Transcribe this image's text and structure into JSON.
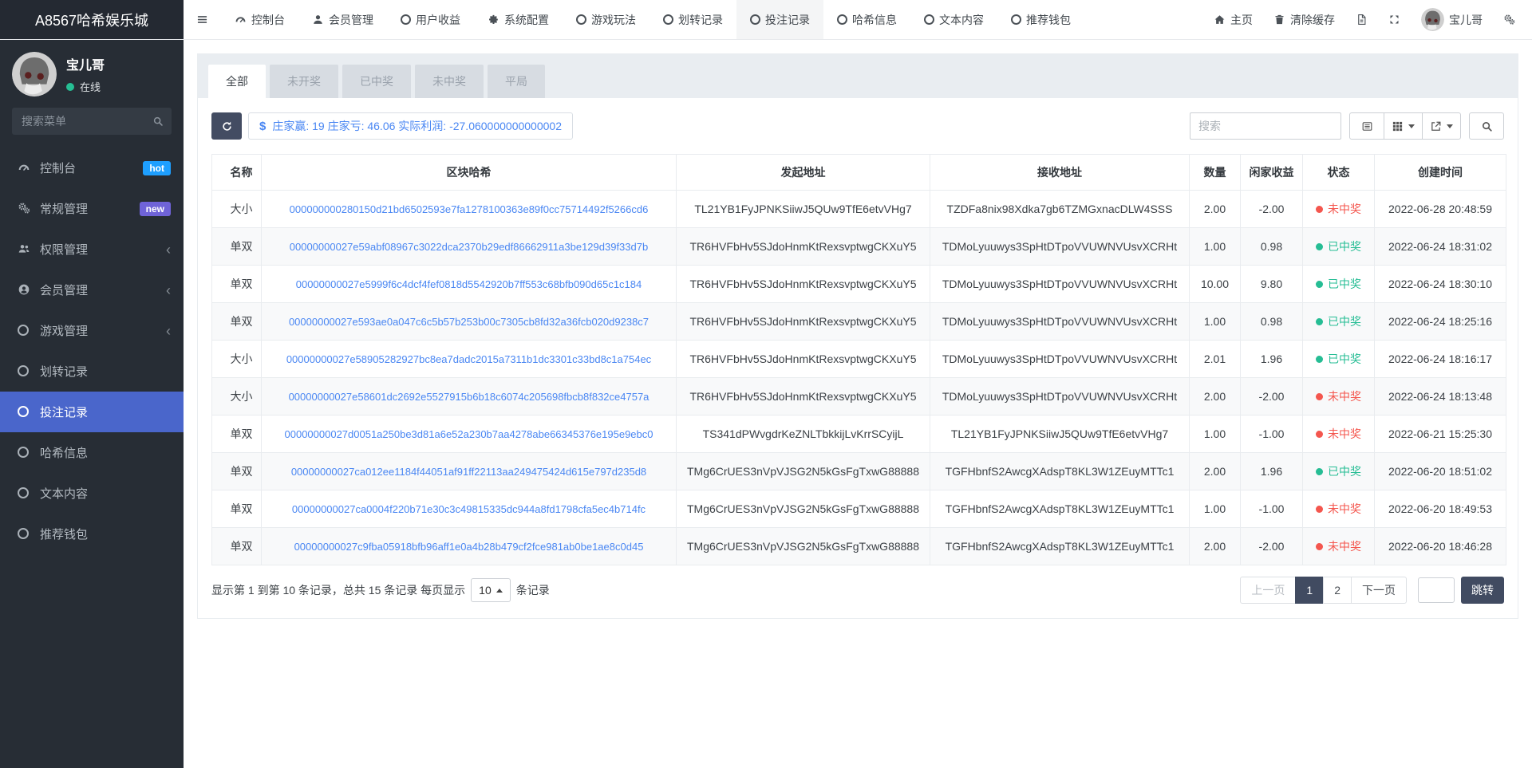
{
  "navbar": {
    "brand": "A8567哈希娱乐城",
    "items": [
      {
        "label": "控制台",
        "icon": "gauge-icon"
      },
      {
        "label": "会员管理",
        "icon": "user-icon"
      },
      {
        "label": "用户收益",
        "icon": "circle-icon"
      },
      {
        "label": "系统配置",
        "icon": "gear-icon"
      },
      {
        "label": "游戏玩法",
        "icon": "circle-icon"
      },
      {
        "label": "划转记录",
        "icon": "circle-icon"
      },
      {
        "label": "投注记录",
        "icon": "circle-icon",
        "active": true
      },
      {
        "label": "哈希信息",
        "icon": "circle-icon"
      },
      {
        "label": "文本内容",
        "icon": "circle-icon"
      },
      {
        "label": "推荐钱包",
        "icon": "circle-icon"
      }
    ],
    "right": {
      "home": "主页",
      "clear_cache": "清除缓存",
      "username": "宝儿哥"
    }
  },
  "sidebar": {
    "username": "宝儿哥",
    "status": "在线",
    "search_placeholder": "搜索菜单",
    "items": [
      {
        "label": "控制台",
        "icon": "gauge-icon",
        "badge": "hot",
        "badge_color": "#1e9fff"
      },
      {
        "label": "常规管理",
        "icon": "cogs-icon",
        "badge": "new",
        "badge_color": "#6f63d8"
      },
      {
        "label": "权限管理",
        "icon": "users-icon",
        "arrow": true
      },
      {
        "label": "会员管理",
        "icon": "user-circle-icon",
        "arrow": true
      },
      {
        "label": "游戏管理",
        "icon": "circle-icon",
        "arrow": true
      },
      {
        "label": "划转记录",
        "icon": "circle-icon"
      },
      {
        "label": "投注记录",
        "icon": "circle-icon",
        "active": true
      },
      {
        "label": "哈希信息",
        "icon": "circle-icon"
      },
      {
        "label": "文本内容",
        "icon": "circle-icon"
      },
      {
        "label": "推荐钱包",
        "icon": "circle-icon"
      }
    ]
  },
  "tabs": [
    {
      "label": "全部",
      "active": true
    },
    {
      "label": "未开奖"
    },
    {
      "label": "已中奖"
    },
    {
      "label": "未中奖"
    },
    {
      "label": "平局"
    }
  ],
  "toolbar": {
    "stats_symbol": "$",
    "stats_text": "庄家赢: 19 庄家亏: 46.06 实际利润: -27.060000000000002",
    "search_placeholder": "搜索"
  },
  "table": {
    "headers": [
      "名称",
      "区块哈希",
      "发起地址",
      "接收地址",
      "数量",
      "闲家收益",
      "状态",
      "创建时间"
    ],
    "rows": [
      {
        "name": "大小",
        "hash": "000000000280150d21bd6502593e7fa1278100363e89f0cc75714492f5266cd6",
        "from": "TL21YB1FyJPNKSiiwJ5QUw9TfE6etvVHg7",
        "to": "TZDFa8nix98Xdka7gb6TZMGxnacDLW4SSS",
        "amount": "2.00",
        "profit": "-2.00",
        "status": "未中奖",
        "status_class": "lose",
        "time": "2022-06-28 20:48:59"
      },
      {
        "name": "单双",
        "hash": "00000000027e59abf08967c3022dca2370b29edf86662911a3be129d39f33d7b",
        "from": "TR6HVFbHv5SJdoHnmKtRexsvptwgCKXuY5",
        "to": "TDMoLyuuwys3SpHtDTpoVVUWNVUsvXCRHt",
        "amount": "1.00",
        "profit": "0.98",
        "status": "已中奖",
        "status_class": "win",
        "time": "2022-06-24 18:31:02"
      },
      {
        "name": "单双",
        "hash": "00000000027e5999f6c4dcf4fef0818d5542920b7ff553c68bfb090d65c1c184",
        "from": "TR6HVFbHv5SJdoHnmKtRexsvptwgCKXuY5",
        "to": "TDMoLyuuwys3SpHtDTpoVVUWNVUsvXCRHt",
        "amount": "10.00",
        "profit": "9.80",
        "status": "已中奖",
        "status_class": "win",
        "time": "2022-06-24 18:30:10"
      },
      {
        "name": "单双",
        "hash": "00000000027e593ae0a047c6c5b57b253b00c7305cb8fd32a36fcb020d9238c7",
        "from": "TR6HVFbHv5SJdoHnmKtRexsvptwgCKXuY5",
        "to": "TDMoLyuuwys3SpHtDTpoVVUWNVUsvXCRHt",
        "amount": "1.00",
        "profit": "0.98",
        "status": "已中奖",
        "status_class": "win",
        "time": "2022-06-24 18:25:16"
      },
      {
        "name": "大小",
        "hash": "00000000027e58905282927bc8ea7dadc2015a7311b1dc3301c33bd8c1a754ec",
        "from": "TR6HVFbHv5SJdoHnmKtRexsvptwgCKXuY5",
        "to": "TDMoLyuuwys3SpHtDTpoVVUWNVUsvXCRHt",
        "amount": "2.01",
        "profit": "1.96",
        "status": "已中奖",
        "status_class": "win",
        "time": "2022-06-24 18:16:17"
      },
      {
        "name": "大小",
        "hash": "00000000027e58601dc2692e5527915b6b18c6074c205698fbcb8f832ce4757a",
        "from": "TR6HVFbHv5SJdoHnmKtRexsvptwgCKXuY5",
        "to": "TDMoLyuuwys3SpHtDTpoVVUWNVUsvXCRHt",
        "amount": "2.00",
        "profit": "-2.00",
        "status": "未中奖",
        "status_class": "lose",
        "time": "2022-06-24 18:13:48"
      },
      {
        "name": "单双",
        "hash": "00000000027d0051a250be3d81a6e52a230b7aa4278abe66345376e195e9ebc0",
        "from": "TS341dPWvgdrKeZNLTbkkijLvKrrSCyijL",
        "to": "TL21YB1FyJPNKSiiwJ5QUw9TfE6etvVHg7",
        "amount": "1.00",
        "profit": "-1.00",
        "status": "未中奖",
        "status_class": "lose",
        "time": "2022-06-21 15:25:30"
      },
      {
        "name": "单双",
        "hash": "00000000027ca012ee1184f44051af91ff22113aa249475424d615e797d235d8",
        "from": "TMg6CrUES3nVpVJSG2N5kGsFgTxwG88888",
        "to": "TGFHbnfS2AwcgXAdspT8KL3W1ZEuyMTTc1",
        "amount": "2.00",
        "profit": "1.96",
        "status": "已中奖",
        "status_class": "win",
        "time": "2022-06-20 18:51:02"
      },
      {
        "name": "单双",
        "hash": "00000000027ca0004f220b71e30c3c49815335dc944a8fd1798cfa5ec4b714fc",
        "from": "TMg6CrUES3nVpVJSG2N5kGsFgTxwG88888",
        "to": "TGFHbnfS2AwcgXAdspT8KL3W1ZEuyMTTc1",
        "amount": "1.00",
        "profit": "-1.00",
        "status": "未中奖",
        "status_class": "lose",
        "time": "2022-06-20 18:49:53"
      },
      {
        "name": "单双",
        "hash": "00000000027c9fba05918bfb96aff1e0a4b28b479cf2fce981ab0be1ae8c0d45",
        "from": "TMg6CrUES3nVpVJSG2N5kGsFgTxwG88888",
        "to": "TGFHbnfS2AwcgXAdspT8KL3W1ZEuyMTTc1",
        "amount": "2.00",
        "profit": "-2.00",
        "status": "未中奖",
        "status_class": "lose",
        "time": "2022-06-20 18:46:28"
      }
    ]
  },
  "pagination": {
    "info_prefix": "显示第 1 到第 10 条记录，总共 15 条记录 每页显示",
    "page_size": "10",
    "info_suffix": "条记录",
    "prev": "上一页",
    "pages": [
      "1",
      "2"
    ],
    "active_page": "1",
    "next": "下一页",
    "jump": "跳转"
  },
  "colors": {
    "sidebar_active": "#4a66cb",
    "status_win": "#26bd94",
    "status_lose": "#f4564e",
    "link_blue": "#4a87f3",
    "dark_button": "#434c62",
    "badge_hot": "#1e9fff",
    "badge_new": "#6f63d8"
  }
}
